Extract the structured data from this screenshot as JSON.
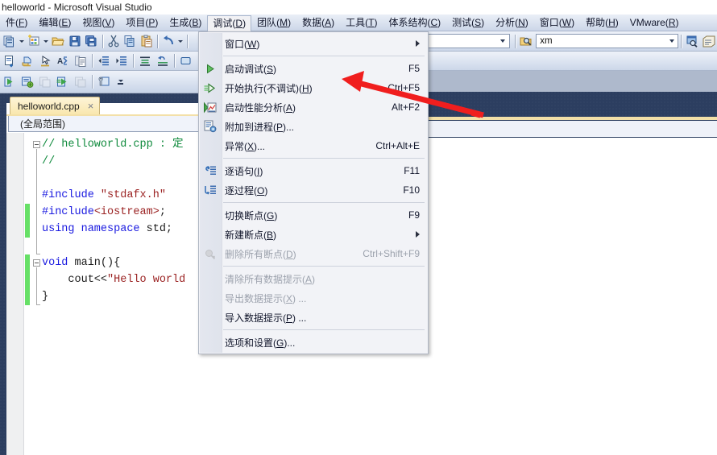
{
  "window": {
    "title": "helloworld - Microsoft Visual Studio"
  },
  "menubar": {
    "items": [
      {
        "label": "件(F)",
        "mnemonic": "F",
        "text_before": "件(",
        "text_after": ")"
      },
      {
        "label": "编辑(E)"
      },
      {
        "label": "视图(V)"
      },
      {
        "label": "项目(P)"
      },
      {
        "label": "生成(B)"
      },
      {
        "label": "调试(D)"
      },
      {
        "label": "团队(M)"
      },
      {
        "label": "数据(A)"
      },
      {
        "label": "工具(T)"
      },
      {
        "label": "体系结构(C)"
      },
      {
        "label": "测试(S)"
      },
      {
        "label": "分析(N)"
      },
      {
        "label": "窗口(W)"
      },
      {
        "label": "帮助(H)"
      },
      {
        "label": "VMware(R)"
      }
    ],
    "active_index": 5
  },
  "toolbar": {
    "find_combo_value": "xm",
    "config_combo_value": ""
  },
  "debug_menu": {
    "items": [
      {
        "label": "窗口(W)",
        "shortcut": "",
        "icon": "",
        "submenu": true,
        "disabled": false
      },
      {
        "separator": true
      },
      {
        "label": "启动调试(S)",
        "shortcut": "F5",
        "icon": "play-green-icon",
        "disabled": false
      },
      {
        "label": "开始执行(不调试)(H)",
        "shortcut": "Ctrl+F5",
        "icon": "run-without-debug-icon",
        "disabled": false
      },
      {
        "label": "启动性能分析(A)",
        "shortcut": "Alt+F2",
        "icon": "performance-chart-icon",
        "disabled": false
      },
      {
        "label": "附加到进程(P)...",
        "shortcut": "",
        "icon": "attach-process-icon",
        "disabled": false
      },
      {
        "label": "异常(X)...",
        "shortcut": "Ctrl+Alt+E",
        "icon": "",
        "disabled": false
      },
      {
        "separator": true
      },
      {
        "label": "逐语句(I)",
        "shortcut": "F11",
        "icon": "step-into-icon",
        "disabled": false
      },
      {
        "label": "逐过程(O)",
        "shortcut": "F10",
        "icon": "step-over-icon",
        "disabled": false
      },
      {
        "separator": true
      },
      {
        "label": "切换断点(G)",
        "shortcut": "F9",
        "icon": "",
        "disabled": false
      },
      {
        "label": "新建断点(B)",
        "shortcut": "",
        "icon": "",
        "submenu": true,
        "disabled": false
      },
      {
        "label": "删除所有断点(D)",
        "shortcut": "Ctrl+Shift+F9",
        "icon": "delete-breakpoints-icon",
        "disabled": true
      },
      {
        "separator": true
      },
      {
        "label": "清除所有数据提示(A)",
        "shortcut": "",
        "icon": "",
        "disabled": true
      },
      {
        "label": "导出数据提示(X) ...",
        "shortcut": "",
        "icon": "",
        "disabled": true
      },
      {
        "label": "导入数据提示(P) ...",
        "shortcut": "",
        "icon": "",
        "disabled": false
      },
      {
        "separator": true
      },
      {
        "label": "选项和设置(G)...",
        "shortcut": "",
        "icon": "",
        "disabled": false
      }
    ]
  },
  "editor": {
    "tab": {
      "label": "helloworld.cpp",
      "close": "×"
    },
    "scope": "(全局范围)",
    "lines": [
      {
        "segments": [
          {
            "t": "// helloworld.cpp : 定",
            "c": "comment"
          }
        ],
        "fold": "start",
        "changed": false
      },
      {
        "segments": [
          {
            "t": "//",
            "c": "comment"
          }
        ],
        "fold": "body",
        "changed": false
      },
      {
        "segments": [
          {
            "t": "",
            "c": "plain"
          }
        ],
        "fold": "body",
        "changed": false
      },
      {
        "segments": [
          {
            "t": "#include ",
            "c": "kw"
          },
          {
            "t": "\"stdafx.h\"",
            "c": "str"
          }
        ],
        "fold": "body",
        "changed": false
      },
      {
        "segments": [
          {
            "t": "#include",
            "c": "kw"
          },
          {
            "t": "<iostream>",
            "c": "str"
          },
          {
            "t": ";",
            "c": "plain"
          }
        ],
        "fold": "body",
        "changed": true
      },
      {
        "segments": [
          {
            "t": "using namespace",
            "c": "kw"
          },
          {
            "t": " std;",
            "c": "plain"
          }
        ],
        "fold": "body",
        "changed": true
      },
      {
        "segments": [
          {
            "t": "",
            "c": "plain"
          }
        ],
        "fold": "end",
        "changed": false
      },
      {
        "segments": [
          {
            "t": "void",
            "c": "kw"
          },
          {
            "t": " main(){",
            "c": "plain"
          }
        ],
        "fold": "start",
        "changed": true
      },
      {
        "segments": [
          {
            "t": "    cout<<",
            "c": "plain"
          },
          {
            "t": "\"Hello world",
            "c": "str"
          }
        ],
        "fold": "body",
        "changed": true
      },
      {
        "segments": [
          {
            "t": "}",
            "c": "plain"
          }
        ],
        "fold": "end",
        "changed": true
      }
    ]
  },
  "annotation": {
    "arrow_color": "#f01e1e",
    "points_to": "Ctrl+F5"
  },
  "colors": {
    "accent_navy": "#2c3e60",
    "tab_yellow": "#f9e7ae",
    "change_green": "#66e066",
    "keyword_blue": "#1a1ae0",
    "string_red": "#9b2323",
    "comment_green": "#0f8a3c"
  }
}
